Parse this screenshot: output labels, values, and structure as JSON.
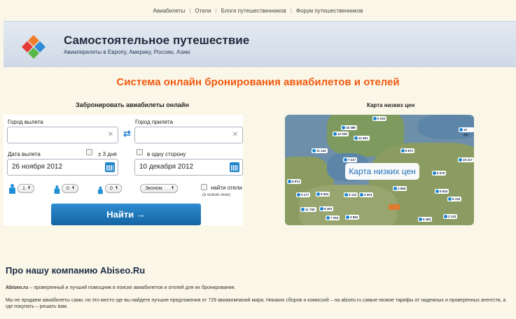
{
  "nav": [
    "Авиабилеты",
    "Отели",
    "Блоги путешественников",
    "Форум путешественников"
  ],
  "header": {
    "title": "Самостоятельное путешествие",
    "subtitle": "Авиаперелеты в Европу, Америку, Россию, Азию"
  },
  "headline": "Система онлайн бронирования авиабилетов и отелей",
  "booking": {
    "title": "Забронировать авиабилеты онлайн",
    "from_label": "Город вылета",
    "to_label": "Город прилета",
    "depart_label": "Дата вылета",
    "flex_label": "± 3 дня",
    "oneway_label": "в одну сторону",
    "depart_date": "26 ноября 2012",
    "return_date": "10 декабря 2012",
    "adults": "1",
    "children": "0",
    "infants": "0",
    "class": "Эконом",
    "hotels_label": "найти отели",
    "hotels_sub": "(в новом окне)",
    "find_button": "Найти →"
  },
  "map": {
    "title": "Карта низких цен",
    "badge": "Карта низких цен",
    "prices": [
      "16 389",
      "6 533",
      "10 287",
      "12 029",
      "11 691",
      "11 143",
      "7 317",
      "8 871",
      "15 217",
      "9 079",
      "8 973",
      "5 177",
      "5 604",
      "5 122",
      "4 003",
      "2 868",
      "9 633",
      "11 765",
      "8 462",
      "3 862",
      "6 484",
      "2 143",
      "9 120",
      "7 254"
    ]
  },
  "about": {
    "title": "Про нашу компанию Abiseo.Ru",
    "p1_brand": "Abiseo.ru",
    "p1_text": " – проверенный и лучший помощник в поиске авиабилетов и отелей для их бронирования.",
    "p2": "Мы не продаем авиабилеты сами, но это место где вы найдете лучшие предложения от 729 авиакомпаний мира. Никаких сборов и комиссий – на abiseo.ru самые низкие тарифы от надежных и проверенных агентств, а где покупать – решать вам."
  },
  "colors": {
    "accent": "#f05a12",
    "button": "#1a74b8",
    "background": "#fbf7e8"
  }
}
